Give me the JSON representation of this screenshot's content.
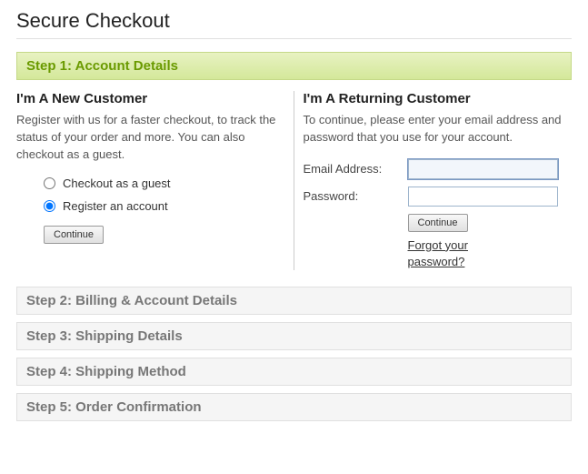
{
  "page_title": "Secure Checkout",
  "steps": [
    {
      "label": "Step 1: Account Details",
      "active": true
    },
    {
      "label": "Step 2: Billing & Account Details",
      "active": false
    },
    {
      "label": "Step 3: Shipping Details",
      "active": false
    },
    {
      "label": "Step 4: Shipping Method",
      "active": false
    },
    {
      "label": "Step 5: Order Confirmation",
      "active": false
    }
  ],
  "new_customer": {
    "heading": "I'm A New Customer",
    "description": "Register with us for a faster checkout, to track the status of your order and more. You can also checkout as a guest.",
    "options": {
      "guest_label": "Checkout as a guest",
      "register_label": "Register an account",
      "selected": "register"
    },
    "continue_label": "Continue"
  },
  "returning_customer": {
    "heading": "I'm A Returning Customer",
    "description": "To continue, please enter your email address and password that you use for your account.",
    "email_label": "Email Address:",
    "email_value": "",
    "password_label": "Password:",
    "password_value": "",
    "continue_label": "Continue",
    "forgot_label": "Forgot your password?"
  }
}
